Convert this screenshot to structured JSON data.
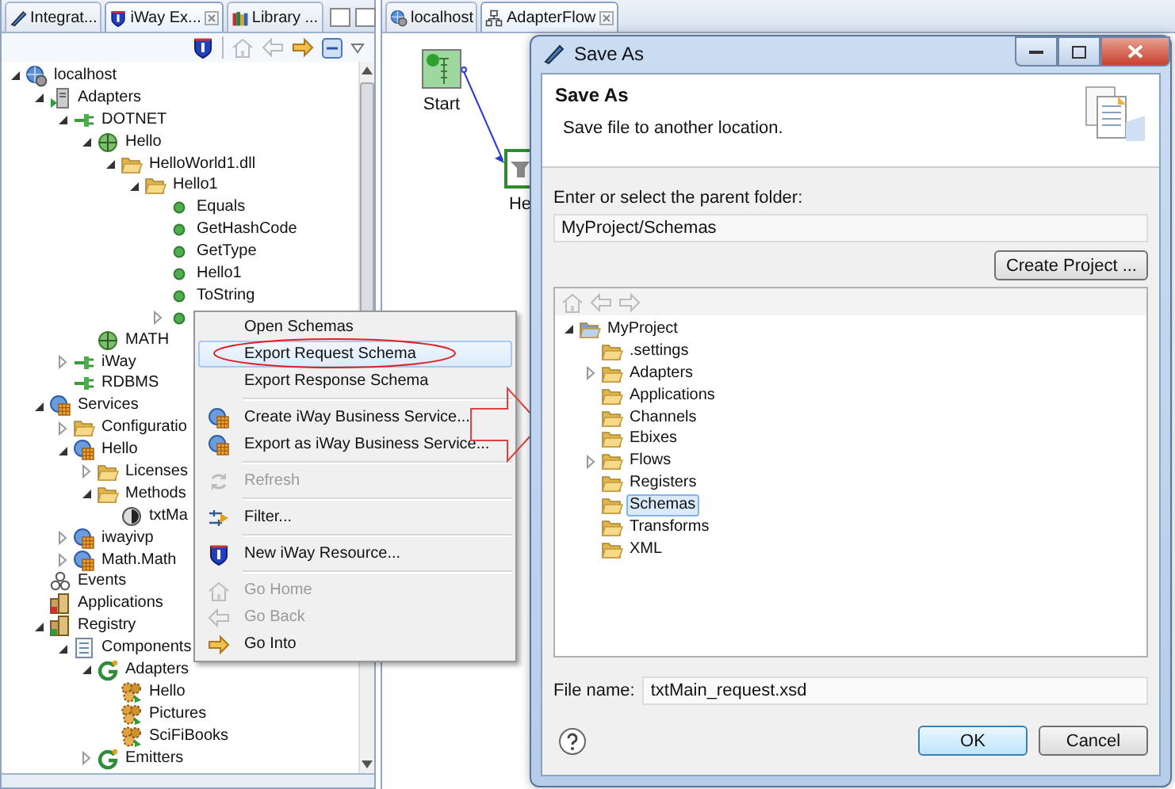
{
  "explorer": {
    "tabs": [
      {
        "label": "Integrat...",
        "kind": "integration",
        "selected": false
      },
      {
        "label": "iWay Ex...",
        "kind": "iway",
        "selected": true
      },
      {
        "label": "Library ...",
        "kind": "library",
        "selected": false
      }
    ],
    "tree": [
      {
        "label": "localhost",
        "kind": "host",
        "expanded": true,
        "children": [
          {
            "label": "Adapters",
            "kind": "adapter",
            "expanded": true,
            "children": [
              {
                "label": "DOTNET",
                "kind": "connector",
                "expanded": true,
                "children": [
                  {
                    "label": "Hello",
                    "kind": "globe",
                    "expanded": true,
                    "children": [
                      {
                        "label": "HelloWorld1.dll",
                        "kind": "folder",
                        "expanded": true,
                        "children": [
                          {
                            "label": "Hello1",
                            "kind": "folder",
                            "expanded": true,
                            "children": [
                              {
                                "label": "Equals",
                                "kind": "method"
                              },
                              {
                                "label": "GetHashCode",
                                "kind": "method"
                              },
                              {
                                "label": "GetType",
                                "kind": "method"
                              },
                              {
                                "label": "Hello1",
                                "kind": "method"
                              },
                              {
                                "label": "ToString",
                                "kind": "method"
                              },
                              {
                                "kind": "method",
                                "expanded": false
                              }
                            ]
                          }
                        ]
                      }
                    ]
                  },
                  {
                    "label": "MATH",
                    "kind": "globe"
                  }
                ]
              },
              {
                "label": "iWay",
                "kind": "connector",
                "expanded": false
              },
              {
                "label": "RDBMS",
                "kind": "connector"
              }
            ]
          },
          {
            "label": "Services",
            "kind": "service",
            "expanded": true,
            "children": [
              {
                "label": "Configuratio",
                "kind": "folder",
                "expanded": false
              },
              {
                "label": "Hello",
                "kind": "service",
                "expanded": true,
                "children": [
                  {
                    "label": "Licenses",
                    "kind": "folder",
                    "expanded": false
                  },
                  {
                    "label": "Methods",
                    "kind": "folder",
                    "expanded": true,
                    "children": [
                      {
                        "label": "txtMa",
                        "kind": "dial"
                      }
                    ]
                  }
                ]
              },
              {
                "label": "iwayivp",
                "kind": "service",
                "expanded": false
              },
              {
                "label": "Math.Math",
                "kind": "service",
                "expanded": false
              }
            ]
          },
          {
            "label": "Events",
            "kind": "events"
          },
          {
            "label": "Applications",
            "kind": "applications"
          },
          {
            "label": "Registry",
            "kind": "registry",
            "expanded": true,
            "children": [
              {
                "label": "Components",
                "kind": "components",
                "expanded": true,
                "children": [
                  {
                    "label": "Adapters",
                    "kind": "group",
                    "expanded": true,
                    "children": [
                      {
                        "label": "Hello",
                        "kind": "gears"
                      },
                      {
                        "label": "Pictures",
                        "kind": "gears"
                      },
                      {
                        "label": "SciFiBooks",
                        "kind": "gears"
                      }
                    ]
                  },
                  {
                    "label": "Emitters",
                    "kind": "group",
                    "expanded": false
                  }
                ]
              }
            ]
          }
        ]
      }
    ]
  },
  "editor": {
    "tabs": [
      {
        "label": "localhost",
        "kind": "host",
        "selected": false
      },
      {
        "label": "AdapterFlow",
        "kind": "flow",
        "selected": true
      }
    ],
    "flow_nodes": [
      {
        "label": "Start",
        "kind": "start"
      },
      {
        "label": "He",
        "kind": "service"
      }
    ]
  },
  "context_menu": [
    {
      "kind": "item",
      "label": "Open Schemas",
      "selected": false,
      "disabled": false
    },
    {
      "kind": "item",
      "label": "Export Request Schema",
      "selected": true,
      "disabled": false
    },
    {
      "kind": "item",
      "label": "Export Response Schema",
      "selected": false,
      "disabled": false
    },
    {
      "kind": "separator"
    },
    {
      "kind": "service",
      "label": "Create iWay Business Service...",
      "selected": false,
      "disabled": false
    },
    {
      "kind": "service",
      "label": "Export as iWay Business Service...",
      "selected": false,
      "disabled": false
    },
    {
      "kind": "separator"
    },
    {
      "kind": "refresh",
      "label": "Refresh",
      "selected": false,
      "disabled": true
    },
    {
      "kind": "separator"
    },
    {
      "kind": "filter",
      "label": "Filter...",
      "selected": false,
      "disabled": false
    },
    {
      "kind": "separator"
    },
    {
      "kind": "resource",
      "label": "New iWay Resource...",
      "selected": false,
      "disabled": false
    },
    {
      "kind": "separator"
    },
    {
      "kind": "home",
      "label": "Go Home",
      "selected": false,
      "disabled": true
    },
    {
      "kind": "back",
      "label": "Go Back",
      "selected": false,
      "disabled": true
    },
    {
      "kind": "into",
      "label": "Go Into",
      "selected": false,
      "disabled": false
    }
  ],
  "dialog": {
    "title": "Save As",
    "heading": "Save As",
    "description": "Save file to another location.",
    "folder_label": "Enter or select the parent folder:",
    "folder_value": "MyProject/Schemas",
    "create_button": "Create Project ...",
    "tree": [
      {
        "label": "MyProject",
        "kind": "project",
        "expanded": true,
        "selected": false,
        "children": [
          {
            "label": ".settings",
            "kind": "folder",
            "selected": false
          },
          {
            "label": "Adapters",
            "kind": "folder",
            "expanded": false,
            "selected": false
          },
          {
            "label": "Applications",
            "kind": "folder",
            "selected": false
          },
          {
            "label": "Channels",
            "kind": "folder",
            "selected": false
          },
          {
            "label": "Ebixes",
            "kind": "folder",
            "selected": false
          },
          {
            "label": "Flows",
            "kind": "folder",
            "expanded": false,
            "selected": false
          },
          {
            "label": "Registers",
            "kind": "folder",
            "selected": false
          },
          {
            "label": "Schemas",
            "kind": "folder",
            "selected": true
          },
          {
            "label": "Transforms",
            "kind": "folder",
            "selected": false
          },
          {
            "label": "XML",
            "kind": "folder",
            "selected": false
          }
        ]
      }
    ],
    "file_name_label": "File name:",
    "file_name_value": "txtMain_request.xsd",
    "buttons": [
      {
        "label": "OK",
        "default": true
      },
      {
        "label": "Cancel",
        "default": false
      }
    ]
  }
}
